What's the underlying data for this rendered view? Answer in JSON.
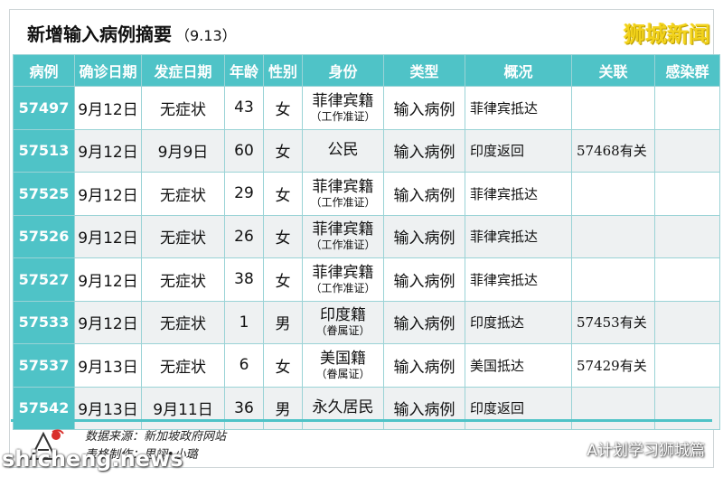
{
  "header": {
    "title": "新增输入病例摘要",
    "date": "（9.13）",
    "brand": "狮城新闻"
  },
  "table": {
    "columns": [
      "病例",
      "确诊日期",
      "发症日期",
      "年龄",
      "性别",
      "身份",
      "类型",
      "概况",
      "关联",
      "感染群"
    ],
    "rows": [
      {
        "case": "57497",
        "confirm": "9月12日",
        "onset": "无症状",
        "age": "43",
        "sex": "女",
        "identity": "菲律宾籍",
        "identity_sub": "（工作准证）",
        "type": "输入病例",
        "summary": "菲律宾抵达",
        "link": "",
        "cluster": ""
      },
      {
        "case": "57513",
        "confirm": "9月12日",
        "onset": "9月9日",
        "age": "60",
        "sex": "女",
        "identity": "公民",
        "identity_sub": "",
        "type": "输入病例",
        "summary": "印度返回",
        "link": "57468有关",
        "cluster": ""
      },
      {
        "case": "57525",
        "confirm": "9月12日",
        "onset": "无症状",
        "age": "29",
        "sex": "女",
        "identity": "菲律宾籍",
        "identity_sub": "（工作准证）",
        "type": "输入病例",
        "summary": "菲律宾抵达",
        "link": "",
        "cluster": ""
      },
      {
        "case": "57526",
        "confirm": "9月12日",
        "onset": "无症状",
        "age": "26",
        "sex": "女",
        "identity": "菲律宾籍",
        "identity_sub": "（工作准证）",
        "type": "输入病例",
        "summary": "菲律宾抵达",
        "link": "",
        "cluster": ""
      },
      {
        "case": "57527",
        "confirm": "9月12日",
        "onset": "无症状",
        "age": "38",
        "sex": "女",
        "identity": "菲律宾籍",
        "identity_sub": "（工作准证）",
        "type": "输入病例",
        "summary": "菲律宾抵达",
        "link": "",
        "cluster": ""
      },
      {
        "case": "57533",
        "confirm": "9月12日",
        "onset": "无症状",
        "age": "1",
        "sex": "男",
        "identity": "印度籍",
        "identity_sub": "（眷属证）",
        "type": "输入病例",
        "summary": "印度抵达",
        "link": "57453有关",
        "cluster": ""
      },
      {
        "case": "57537",
        "confirm": "9月13日",
        "onset": "无症状",
        "age": "6",
        "sex": "女",
        "identity": "美国籍",
        "identity_sub": "（眷属证）",
        "type": "输入病例",
        "summary": "美国抵达",
        "link": "57429有关",
        "cluster": ""
      },
      {
        "case": "57542",
        "confirm": "9月13日",
        "onset": "9月11日",
        "age": "36",
        "sex": "男",
        "identity": "永久居民",
        "identity_sub": "",
        "type": "输入病例",
        "summary": "印度返回",
        "link": "",
        "cluster": ""
      }
    ]
  },
  "footer": {
    "source": "数据来源：新加坡政府网站",
    "maker": "表格制作：思翊•小璐",
    "watermark_left": "shicheng.news",
    "watermark_right": "A计划学习狮城篇",
    "wechat_icon": "wechat-icon"
  },
  "colors": {
    "header_teal": "#4fc3c7",
    "row_alt": "#eef1f2",
    "brand_yellow": "#f2d21b"
  }
}
